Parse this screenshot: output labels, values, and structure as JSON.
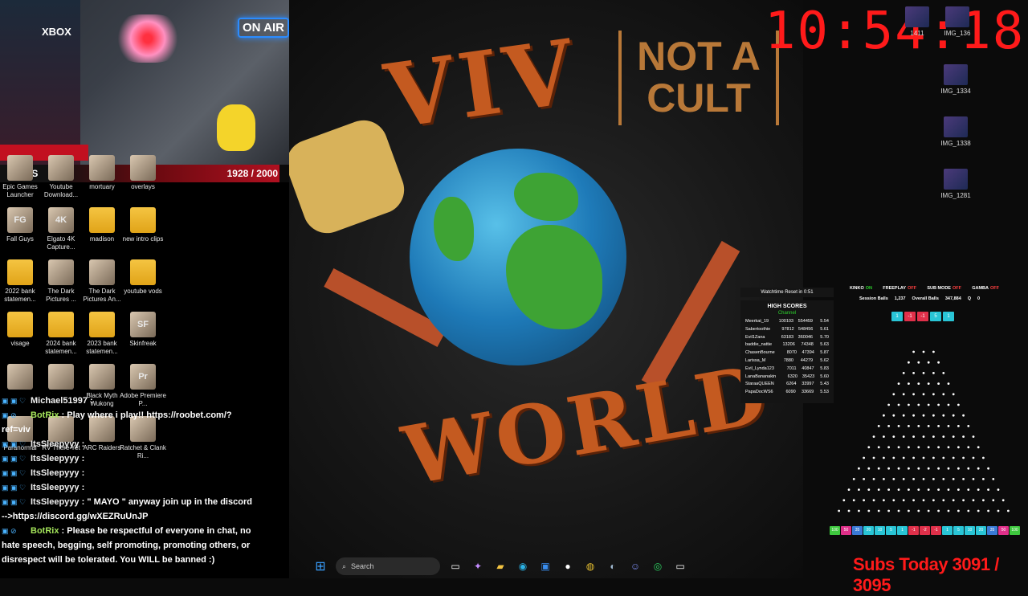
{
  "webcam": {
    "xbox": "XBOX",
    "on_air": "ON AIR"
  },
  "subs_bar": {
    "label": "SUBS",
    "progress": "1928 / 2000",
    "fraction": 0.964
  },
  "desktop_left": [
    {
      "label": "Epic Games Launcher",
      "glyph": "",
      "kind": "img",
      "x": 0,
      "y": 0
    },
    {
      "label": "Youtube Download...",
      "glyph": "",
      "kind": "img",
      "x": 1,
      "y": 0
    },
    {
      "label": "mortuary",
      "glyph": "",
      "kind": "img",
      "x": 2,
      "y": 0
    },
    {
      "label": "overlays",
      "glyph": "",
      "kind": "img",
      "x": 3,
      "y": 0
    },
    {
      "label": "Fall Guys",
      "glyph": "FG",
      "kind": "img",
      "x": 0,
      "y": 1
    },
    {
      "label": "Elgato 4K Capture...",
      "glyph": "4K",
      "kind": "img",
      "x": 1,
      "y": 1
    },
    {
      "label": "madison",
      "glyph": "",
      "kind": "folder",
      "x": 2,
      "y": 1
    },
    {
      "label": "new intro clips",
      "glyph": "",
      "kind": "folder",
      "x": 3,
      "y": 1
    },
    {
      "label": "2022 bank statemen...",
      "glyph": "",
      "kind": "folder",
      "x": 0,
      "y": 2
    },
    {
      "label": "The Dark Pictures ...",
      "glyph": "",
      "kind": "img",
      "x": 1,
      "y": 2
    },
    {
      "label": "The Dark Pictures An...",
      "glyph": "",
      "kind": "img",
      "x": 2,
      "y": 2
    },
    {
      "label": "youtube vods",
      "glyph": "",
      "kind": "folder",
      "x": 3,
      "y": 2
    },
    {
      "label": "visage",
      "glyph": "",
      "kind": "folder",
      "x": 0,
      "y": 3
    },
    {
      "label": "2024 bank statemen...",
      "glyph": "",
      "kind": "folder",
      "x": 1,
      "y": 3
    },
    {
      "label": "2023 bank statemen...",
      "glyph": "",
      "kind": "folder",
      "x": 2,
      "y": 3
    },
    {
      "label": "Skinfreak",
      "glyph": "SF",
      "kind": "img",
      "x": 3,
      "y": 3
    },
    {
      "label": "",
      "glyph": "",
      "kind": "img",
      "x": 0,
      "y": 4
    },
    {
      "label": "",
      "glyph": "",
      "kind": "img",
      "x": 1,
      "y": 4
    },
    {
      "label": "Black Myth Wukong",
      "glyph": "",
      "kind": "img",
      "x": 2,
      "y": 4
    },
    {
      "label": "Adobe Premiere P...",
      "glyph": "Pr",
      "kind": "img",
      "x": 3,
      "y": 4
    },
    {
      "label": "Paranormal",
      "glyph": "",
      "kind": "img",
      "x": 0,
      "y": 5
    },
    {
      "label": "RV There Yet",
      "glyph": "",
      "kind": "img",
      "x": 1,
      "y": 5
    },
    {
      "label": "ARC Raiders",
      "glyph": "",
      "kind": "img",
      "x": 2,
      "y": 5
    },
    {
      "label": "Ratchet & Clank Ri...",
      "glyph": "",
      "kind": "img",
      "x": 3,
      "y": 5
    }
  ],
  "album": {
    "top_word": "VIV",
    "bottom_word": "WORLD",
    "tag_line1": "NOT A",
    "tag_line2": "CULT"
  },
  "clock": "10:54:18",
  "desktop_right": [
    {
      "label": "1411",
      "y": 0
    },
    {
      "label": "IMG_136",
      "y": 0
    },
    {
      "label": "IMG_1334",
      "y": 1
    },
    {
      "label": "IMG_1338",
      "y": 2
    },
    {
      "label": "IMG_1281",
      "y": 3
    }
  ],
  "watchtime": "Watchtime Reset in 0:51",
  "highscores": {
    "title": "HIGH SCORES",
    "channel": "Channel",
    "rows": [
      {
        "name": "Meerkat_19",
        "score": "100103",
        "val": "554459",
        "ratio": "5.54"
      },
      {
        "name": "Sabertoothie",
        "score": "97812",
        "val": "548456",
        "ratio": "5.61"
      },
      {
        "name": "Evil1Zana",
        "score": "63183",
        "val": "360046",
        "ratio": "5.70"
      },
      {
        "name": "baddie_nattie",
        "score": "13206",
        "val": "74348",
        "ratio": "5.63"
      },
      {
        "name": "ChasenBourne",
        "score": "8070",
        "val": "47394",
        "ratio": "5.87"
      },
      {
        "name": "Larissa_M",
        "score": "7880",
        "val": "44279",
        "ratio": "5.62"
      },
      {
        "name": "Evil_Lynda123",
        "score": "7011",
        "val": "40847",
        "ratio": "5.83"
      },
      {
        "name": "LanaBananakin",
        "score": "6320",
        "val": "35423",
        "ratio": "5.60"
      },
      {
        "name": "StaraaQUEEN",
        "score": "6264",
        "val": "33997",
        "ratio": "5.43"
      },
      {
        "name": "PapaDocWS6",
        "score": "6090",
        "val": "33669",
        "ratio": "5.53"
      }
    ]
  },
  "plinko": {
    "toggles": [
      {
        "label": "KINKO",
        "state": "ON"
      },
      {
        "label": "FREEPLAY",
        "state": "OFF"
      },
      {
        "label": "SUB MODE",
        "state": "OFF"
      },
      {
        "label": "GAMBA",
        "state": "OFF"
      }
    ],
    "session_label": "Session Balls",
    "session_value": "1,237",
    "overall_label": "Overall Balls",
    "overall_value": "347,884",
    "extra_q": "Q",
    "extra_v": "0",
    "top_multipliers": [
      {
        "v": "1",
        "c": "#29c5d6"
      },
      {
        "v": "-1",
        "c": "#e0304a"
      },
      {
        "v": "-1",
        "c": "#e0304a"
      },
      {
        "v": "5",
        "c": "#29c5d6"
      },
      {
        "v": "1",
        "c": "#29c5d6"
      }
    ],
    "rows": 16,
    "bottom_multipliers": [
      {
        "v": "100",
        "c": "#3ec83e"
      },
      {
        "v": "50",
        "c": "#e0308a"
      },
      {
        "v": "35",
        "c": "#3a7ad6"
      },
      {
        "v": "20",
        "c": "#29c5d6"
      },
      {
        "v": "10",
        "c": "#29c5d6"
      },
      {
        "v": "5",
        "c": "#29c5d6"
      },
      {
        "v": "1",
        "c": "#29c5d6"
      },
      {
        "v": "-1",
        "c": "#e0304a"
      },
      {
        "v": "-2",
        "c": "#e0304a"
      },
      {
        "v": "-1",
        "c": "#e0304a"
      },
      {
        "v": "1",
        "c": "#29c5d6"
      },
      {
        "v": "5",
        "c": "#29c5d6"
      },
      {
        "v": "10",
        "c": "#29c5d6"
      },
      {
        "v": "20",
        "c": "#29c5d6"
      },
      {
        "v": "35",
        "c": "#3a7ad6"
      },
      {
        "v": "50",
        "c": "#e0308a"
      },
      {
        "v": "100",
        "c": "#3ec83e"
      }
    ]
  },
  "chat": [
    {
      "user": "Michael51997",
      "sep": " :",
      "text": "",
      "bot": false
    },
    {
      "user": "BotRix",
      "sep": " : ",
      "text": "Play where i play!! https://roobet.com/?ref=viv",
      "bot": true
    },
    {
      "user": "ItsSleepyyy",
      "sep": " :",
      "text": "",
      "bot": false
    },
    {
      "user": "ItsSleepyyy",
      "sep": " :",
      "text": "",
      "bot": false
    },
    {
      "user": "ItsSleepyyy",
      "sep": " :",
      "text": "",
      "bot": false
    },
    {
      "user": "ItsSleepyyy",
      "sep": " :",
      "text": "",
      "bot": false
    },
    {
      "user": "ItsSleepyyy",
      "sep": " : ",
      "text": "\" MAYO \" anyway join up in the discord -->https://discord.gg/wXEZRuUnJP",
      "bot": false
    },
    {
      "user": "BotRix",
      "sep": " : ",
      "text": "Please be respectful of everyone in chat, no hate speech, begging, self promoting, promoting others, or disrespect will be tolerated. You WILL be banned :)",
      "bot": true
    }
  ],
  "taskbar": {
    "search_placeholder": "Search"
  },
  "subs_today": "Subs Today 3091 / 3095"
}
